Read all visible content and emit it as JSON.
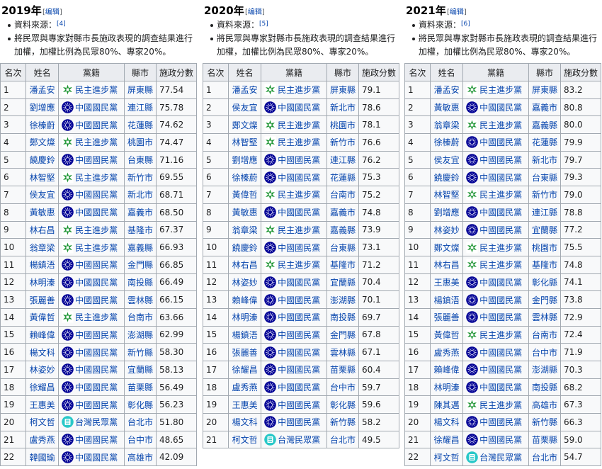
{
  "columns": [
    {
      "heading": "2019年",
      "edit_label": "编辑",
      "notes": [
        "資料來源：",
        "將民眾與專家對縣市長施政表現的調查結果進行加權，加權比例為民眾80%、專家20%。"
      ],
      "ref": "[4]",
      "headers": [
        "名次",
        "姓名",
        "黨籍",
        "縣市",
        "施政分數"
      ],
      "rows": [
        {
          "rank": "1",
          "name": "潘孟安",
          "party": "民主進步黨",
          "party_key": "dpp",
          "city": "屏東縣",
          "score": "77.54"
        },
        {
          "rank": "2",
          "name": "劉增應",
          "party": "中國國民黨",
          "party_key": "kmt",
          "city": "連江縣",
          "score": "75.78"
        },
        {
          "rank": "3",
          "name": "徐榛蔚",
          "party": "中國國民黨",
          "party_key": "kmt",
          "city": "花蓮縣",
          "score": "74.62"
        },
        {
          "rank": "4",
          "name": "鄭文燦",
          "party": "民主進步黨",
          "party_key": "dpp",
          "city": "桃園市",
          "score": "74.47"
        },
        {
          "rank": "5",
          "name": "饒慶鈴",
          "party": "中國國民黨",
          "party_key": "kmt",
          "city": "台東縣",
          "score": "71.16"
        },
        {
          "rank": "6",
          "name": "林智堅",
          "party": "民主進步黨",
          "party_key": "dpp",
          "city": "新竹市",
          "score": "69.55"
        },
        {
          "rank": "7",
          "name": "侯友宜",
          "party": "中國國民黨",
          "party_key": "kmt",
          "city": "新北市",
          "score": "68.71"
        },
        {
          "rank": "8",
          "name": "黃敏惠",
          "party": "中國國民黨",
          "party_key": "kmt",
          "city": "嘉義市",
          "score": "68.50"
        },
        {
          "rank": "9",
          "name": "林右昌",
          "party": "民主進步黨",
          "party_key": "dpp",
          "city": "基隆市",
          "score": "67.37"
        },
        {
          "rank": "10",
          "name": "翁章梁",
          "party": "民主進步黨",
          "party_key": "dpp",
          "city": "嘉義縣",
          "score": "66.93"
        },
        {
          "rank": "11",
          "name": "楊鎮浯",
          "party": "中國國民黨",
          "party_key": "kmt",
          "city": "金門縣",
          "score": "66.85"
        },
        {
          "rank": "12",
          "name": "林明溱",
          "party": "中國國民黨",
          "party_key": "kmt",
          "city": "南投縣",
          "score": "66.49"
        },
        {
          "rank": "13",
          "name": "張麗善",
          "party": "中國國民黨",
          "party_key": "kmt",
          "city": "雲林縣",
          "score": "66.15"
        },
        {
          "rank": "14",
          "name": "黃偉哲",
          "party": "民主進步黨",
          "party_key": "dpp",
          "city": "台南市",
          "score": "63.66"
        },
        {
          "rank": "15",
          "name": "賴峰偉",
          "party": "中國國民黨",
          "party_key": "kmt",
          "city": "澎湖縣",
          "score": "62.99"
        },
        {
          "rank": "16",
          "name": "楊文科",
          "party": "中國國民黨",
          "party_key": "kmt",
          "city": "新竹縣",
          "score": "58.30"
        },
        {
          "rank": "17",
          "name": "林姿妙",
          "party": "中國國民黨",
          "party_key": "kmt",
          "city": "宜蘭縣",
          "score": "58.13"
        },
        {
          "rank": "18",
          "name": "徐耀昌",
          "party": "中國國民黨",
          "party_key": "kmt",
          "city": "苗栗縣",
          "score": "56.49"
        },
        {
          "rank": "19",
          "name": "王惠美",
          "party": "中國國民黨",
          "party_key": "kmt",
          "city": "彰化縣",
          "score": "56.23"
        },
        {
          "rank": "20",
          "name": "柯文哲",
          "party": "台灣民眾黨",
          "party_key": "tpp",
          "city": "台北市",
          "score": "51.80"
        },
        {
          "rank": "21",
          "name": "盧秀燕",
          "party": "中國國民黨",
          "party_key": "kmt",
          "city": "台中市",
          "score": "48.65"
        },
        {
          "rank": "22",
          "name": "韓國瑜",
          "party": "中國國民黨",
          "party_key": "kmt",
          "city": "高雄市",
          "score": "42.09"
        }
      ]
    },
    {
      "heading": "2020年",
      "edit_label": "编辑",
      "notes": [
        "資料來源：",
        "將民眾與專家對縣市長施政表現的調查結果進行加權，加權比例為民眾80%、專家20%。"
      ],
      "ref": "[5]",
      "headers": [
        "名次",
        "姓名",
        "黨籍",
        "縣市",
        "施政分數"
      ],
      "rows": [
        {
          "rank": "1",
          "name": "潘孟安",
          "party": "民主進步黨",
          "party_key": "dpp",
          "city": "屏東縣",
          "score": "79.1"
        },
        {
          "rank": "2",
          "name": "侯友宜",
          "party": "中國國民黨",
          "party_key": "kmt",
          "city": "新北市",
          "score": "78.6"
        },
        {
          "rank": "3",
          "name": "鄭文燦",
          "party": "民主進步黨",
          "party_key": "dpp",
          "city": "桃園市",
          "score": "78.1"
        },
        {
          "rank": "4",
          "name": "林智堅",
          "party": "民主進步黨",
          "party_key": "dpp",
          "city": "新竹市",
          "score": "76.6"
        },
        {
          "rank": "5",
          "name": "劉增應",
          "party": "中國國民黨",
          "party_key": "kmt",
          "city": "連江縣",
          "score": "76.2"
        },
        {
          "rank": "6",
          "name": "徐榛蔚",
          "party": "中國國民黨",
          "party_key": "kmt",
          "city": "花蓮縣",
          "score": "75.3"
        },
        {
          "rank": "7",
          "name": "黃偉哲",
          "party": "民主進步黨",
          "party_key": "dpp",
          "city": "台南市",
          "score": "75.2"
        },
        {
          "rank": "8",
          "name": "黃敏惠",
          "party": "中國國民黨",
          "party_key": "kmt",
          "city": "嘉義市",
          "score": "74.8"
        },
        {
          "rank": "9",
          "name": "翁章梁",
          "party": "民主進步黨",
          "party_key": "dpp",
          "city": "嘉義縣",
          "score": "73.9"
        },
        {
          "rank": "10",
          "name": "饒慶鈴",
          "party": "中國國民黨",
          "party_key": "kmt",
          "city": "台東縣",
          "score": "73.1"
        },
        {
          "rank": "11",
          "name": "林右昌",
          "party": "民主進步黨",
          "party_key": "dpp",
          "city": "基隆市",
          "score": "71.2"
        },
        {
          "rank": "12",
          "name": "林姿妙",
          "party": "中國國民黨",
          "party_key": "kmt",
          "city": "宜蘭縣",
          "score": "70.4"
        },
        {
          "rank": "13",
          "name": "賴峰偉",
          "party": "中國國民黨",
          "party_key": "kmt",
          "city": "澎湖縣",
          "score": "70.1"
        },
        {
          "rank": "14",
          "name": "林明溱",
          "party": "中國國民黨",
          "party_key": "kmt",
          "city": "南投縣",
          "score": "69.7"
        },
        {
          "rank": "15",
          "name": "楊鎮浯",
          "party": "中國國民黨",
          "party_key": "kmt",
          "city": "金門縣",
          "score": "67.8"
        },
        {
          "rank": "16",
          "name": "張麗善",
          "party": "中國國民黨",
          "party_key": "kmt",
          "city": "雲林縣",
          "score": "67.1"
        },
        {
          "rank": "17",
          "name": "徐耀昌",
          "party": "中國國民黨",
          "party_key": "kmt",
          "city": "苗栗縣",
          "score": "60.4"
        },
        {
          "rank": "18",
          "name": "盧秀燕",
          "party": "中國國民黨",
          "party_key": "kmt",
          "city": "台中市",
          "score": "59.7"
        },
        {
          "rank": "19",
          "name": "王惠美",
          "party": "中國國民黨",
          "party_key": "kmt",
          "city": "彰化縣",
          "score": "59.6"
        },
        {
          "rank": "20",
          "name": "楊文科",
          "party": "中國國民黨",
          "party_key": "kmt",
          "city": "新竹縣",
          "score": "58.2"
        },
        {
          "rank": "21",
          "name": "柯文哲",
          "party": "台灣民眾黨",
          "party_key": "tpp",
          "city": "台北市",
          "score": "49.5"
        }
      ]
    },
    {
      "heading": "2021年",
      "edit_label": "编辑",
      "notes": [
        "資料來源：",
        "將民眾與專家對縣市長施政表現的調查結果進行加權，加權比例為民眾80%、專家20%。"
      ],
      "ref": "[6]",
      "headers": [
        "名次",
        "姓名",
        "黨籍",
        "縣市",
        "施政分數"
      ],
      "rows": [
        {
          "rank": "1",
          "name": "潘孟安",
          "party": "民主進步黨",
          "party_key": "dpp",
          "city": "屏東縣",
          "score": "83.2"
        },
        {
          "rank": "2",
          "name": "黃敏惠",
          "party": "中國國民黨",
          "party_key": "kmt",
          "city": "嘉義市",
          "score": "80.8"
        },
        {
          "rank": "3",
          "name": "翁章梁",
          "party": "民主進步黨",
          "party_key": "dpp",
          "city": "嘉義縣",
          "score": "80.0"
        },
        {
          "rank": "4",
          "name": "徐榛蔚",
          "party": "中國國民黨",
          "party_key": "kmt",
          "city": "花蓮縣",
          "score": "79.9"
        },
        {
          "rank": "5",
          "name": "侯友宜",
          "party": "中國國民黨",
          "party_key": "kmt",
          "city": "新北市",
          "score": "79.7"
        },
        {
          "rank": "6",
          "name": "饒慶鈴",
          "party": "中國國民黨",
          "party_key": "kmt",
          "city": "台東縣",
          "score": "79.3"
        },
        {
          "rank": "7",
          "name": "林智堅",
          "party": "民主進步黨",
          "party_key": "dpp",
          "city": "新竹市",
          "score": "79.0"
        },
        {
          "rank": "8",
          "name": "劉增應",
          "party": "中國國民黨",
          "party_key": "kmt",
          "city": "連江縣",
          "score": "78.8"
        },
        {
          "rank": "9",
          "name": "林姿妙",
          "party": "中國國民黨",
          "party_key": "kmt",
          "city": "宜蘭縣",
          "score": "77.2"
        },
        {
          "rank": "10",
          "name": "鄭文燦",
          "party": "民主進步黨",
          "party_key": "dpp",
          "city": "桃園市",
          "score": "75.5"
        },
        {
          "rank": "11",
          "name": "林右昌",
          "party": "民主進步黨",
          "party_key": "dpp",
          "city": "基隆市",
          "score": "74.8"
        },
        {
          "rank": "12",
          "name": "王惠美",
          "party": "中國國民黨",
          "party_key": "kmt",
          "city": "彰化縣",
          "score": "74.1"
        },
        {
          "rank": "13",
          "name": "楊鎮浯",
          "party": "中國國民黨",
          "party_key": "kmt",
          "city": "金門縣",
          "score": "73.8"
        },
        {
          "rank": "14",
          "name": "張麗善",
          "party": "中國國民黨",
          "party_key": "kmt",
          "city": "雲林縣",
          "score": "72.9"
        },
        {
          "rank": "15",
          "name": "黃偉哲",
          "party": "民主進步黨",
          "party_key": "dpp",
          "city": "台南市",
          "score": "72.4"
        },
        {
          "rank": "16",
          "name": "盧秀燕",
          "party": "中國國民黨",
          "party_key": "kmt",
          "city": "台中市",
          "score": "71.9"
        },
        {
          "rank": "17",
          "name": "賴峰偉",
          "party": "中國國民黨",
          "party_key": "kmt",
          "city": "澎湖縣",
          "score": "70.3"
        },
        {
          "rank": "18",
          "name": "林明溱",
          "party": "中國國民黨",
          "party_key": "kmt",
          "city": "南投縣",
          "score": "68.2"
        },
        {
          "rank": "19",
          "name": "陳其邁",
          "party": "民主進步黨",
          "party_key": "dpp",
          "city": "高雄市",
          "score": "67.3"
        },
        {
          "rank": "20",
          "name": "楊文科",
          "party": "中國國民黨",
          "party_key": "kmt",
          "city": "新竹縣",
          "score": "66.3"
        },
        {
          "rank": "21",
          "name": "徐耀昌",
          "party": "中國國民黨",
          "party_key": "kmt",
          "city": "苗栗縣",
          "score": "59.0"
        },
        {
          "rank": "22",
          "name": "柯文哲",
          "party": "台灣民眾黨",
          "party_key": "tpp",
          "city": "台北市",
          "score": "54.7"
        }
      ]
    }
  ],
  "party_colors": {
    "dpp": "#1b9431",
    "kmt": "#000095",
    "tpp": "#28c8c8"
  },
  "party_icons": {
    "dpp": "dpp-flag-icon",
    "kmt": "kmt-sun-icon",
    "tpp": "tpp-logo-icon"
  },
  "colors": {
    "link": "#0645ad",
    "header_bg": "#eaecf0",
    "cell_bg": "#f8f9fa",
    "border": "#a2a9b1"
  }
}
